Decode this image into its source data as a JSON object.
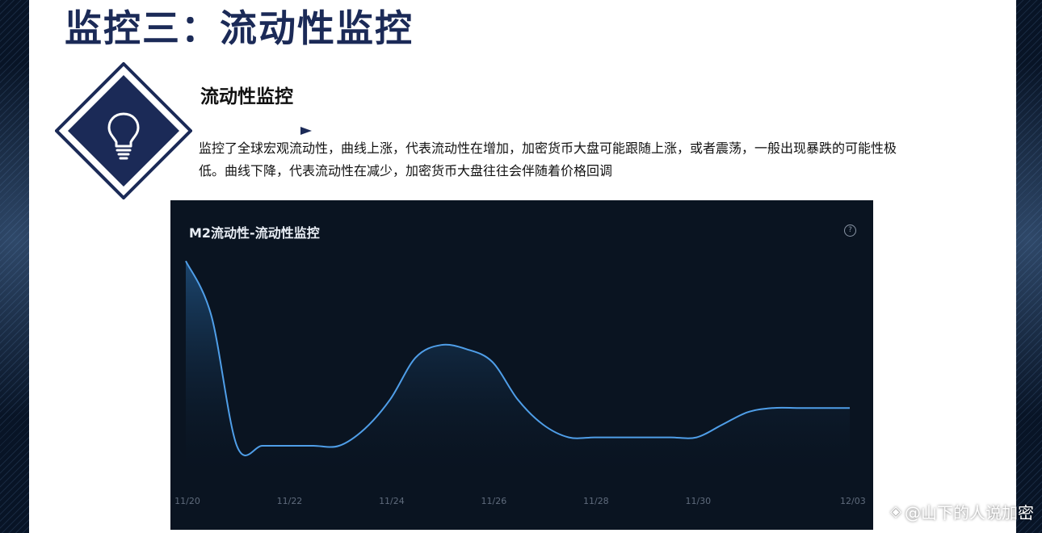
{
  "slide": {
    "title": "监控三：流动性监控",
    "subtitle": "流动性监控",
    "description": "监控了全球宏观流动性，曲线上涨，代表流动性在增加，加密货币大盘可能跟随上涨，或者震荡，一般出现暴跌的可能性极低。曲线下降，代表流动性在减少，加密货币大盘往往会伴随着价格回调"
  },
  "icons": {
    "main_icon": "lightbulb-icon",
    "help": "help-circle-icon",
    "watermark": "weibo-diamond-icon"
  },
  "help_glyph": "?",
  "watermark": {
    "text": "@山下的人说加密"
  },
  "colors": {
    "title_navy": "#1b2a57",
    "chart_bg": "#0a1421",
    "line_blue": "#4f9ee8"
  },
  "chart_data": {
    "type": "area",
    "title": "M2流动性-流动性监控",
    "xlabel": "",
    "ylabel": "",
    "grid": false,
    "legend": "none",
    "x": [
      "11/20",
      "11/20.5",
      "11/21",
      "11/21.5",
      "11/22",
      "11/22.5",
      "11/23",
      "11/23.5",
      "11/24",
      "11/24.5",
      "11/25",
      "11/25.5",
      "11/26",
      "11/26.5",
      "11/27",
      "11/27.5",
      "11/28",
      "11/28.5",
      "11/29",
      "11/29.5",
      "11/30",
      "11/30.5",
      "12/01",
      "12/01.5",
      "12/02",
      "12/02.5",
      "12/03"
    ],
    "tick_labels": [
      "11/20",
      "11/22",
      "11/24",
      "11/26",
      "11/28",
      "11/30",
      "12/03"
    ],
    "tick_index": [
      0,
      4,
      8,
      12,
      16,
      20,
      26
    ],
    "values": [
      98,
      72,
      10,
      10,
      10,
      10,
      10,
      18,
      32,
      52,
      58,
      56,
      50,
      32,
      20,
      14,
      14,
      14,
      14,
      14,
      14,
      20,
      26,
      28,
      28,
      28,
      28
    ],
    "ylim": [
      0,
      100
    ],
    "series_color": "#4f9ee8"
  }
}
